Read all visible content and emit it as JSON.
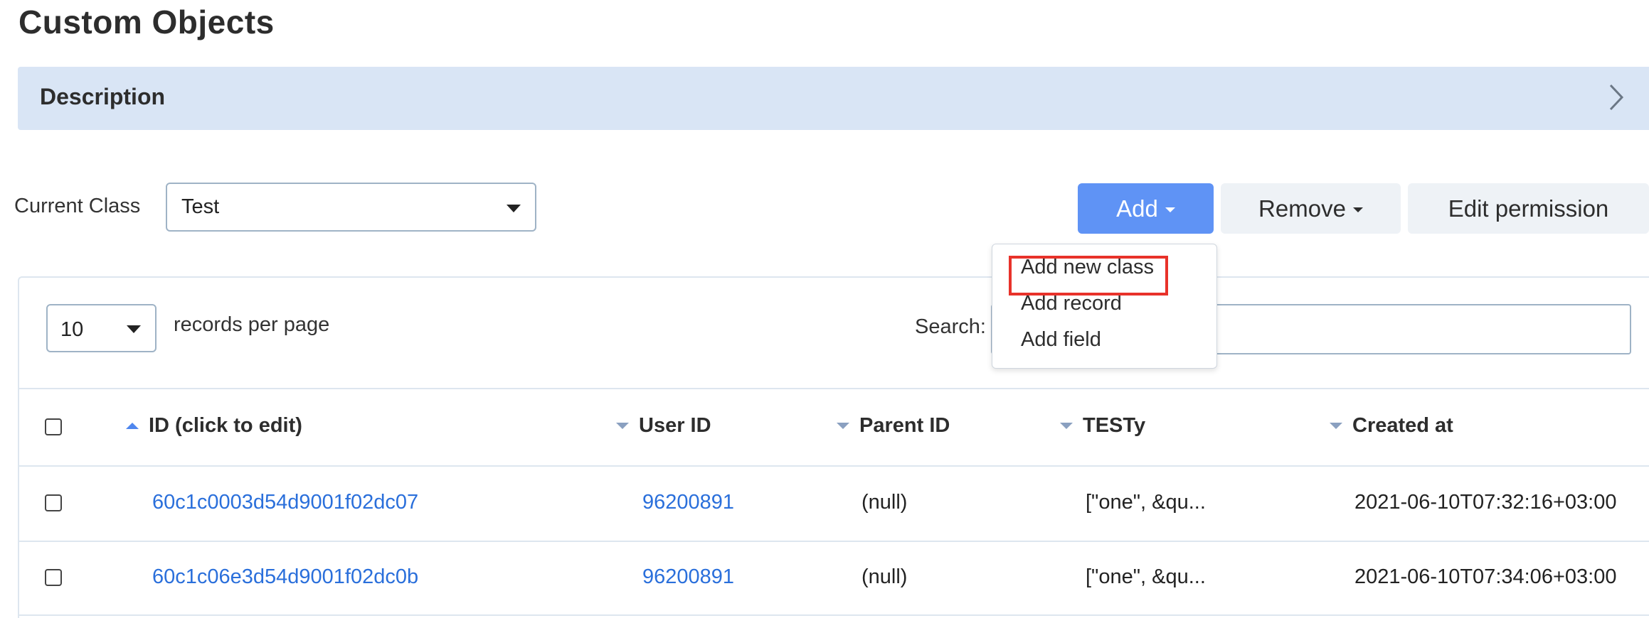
{
  "page": {
    "title": "Custom Objects"
  },
  "description": {
    "label": "Description",
    "icon": "chevron-right-icon"
  },
  "class_selector": {
    "label": "Current Class",
    "value": "Test"
  },
  "actions": {
    "add_label": "Add",
    "remove_label": "Remove",
    "edit_permission_label": "Edit permission",
    "add_color": "#5f93f5"
  },
  "add_menu": {
    "items": [
      {
        "label": "Add new class",
        "highlighted": true
      },
      {
        "label": "Add record",
        "highlighted": false
      },
      {
        "label": "Add field",
        "highlighted": false
      }
    ],
    "highlight_color": "#e8322a"
  },
  "table": {
    "per_page_value": "10",
    "per_page_label": "records per page",
    "search_label": "Search:",
    "search_value": "",
    "columns": [
      {
        "label": "ID (click to edit)",
        "sort": "asc"
      },
      {
        "label": "User ID",
        "sort": "desc"
      },
      {
        "label": "Parent ID",
        "sort": "desc"
      },
      {
        "label": "TESTy",
        "sort": "desc"
      },
      {
        "label": "Created at",
        "sort": "desc"
      }
    ],
    "rows": [
      {
        "id": "60c1c0003d54d9001f02dc07",
        "user_id": "96200891",
        "parent_id": "(null)",
        "testy": "[\"one\", &qu...",
        "created_at": "2021-06-10T07:32:16+03:00"
      },
      {
        "id": "60c1c06e3d54d9001f02dc0b",
        "user_id": "96200891",
        "parent_id": "(null)",
        "testy": "[\"one\", &qu...",
        "created_at": "2021-06-10T07:34:06+03:00"
      }
    ]
  }
}
